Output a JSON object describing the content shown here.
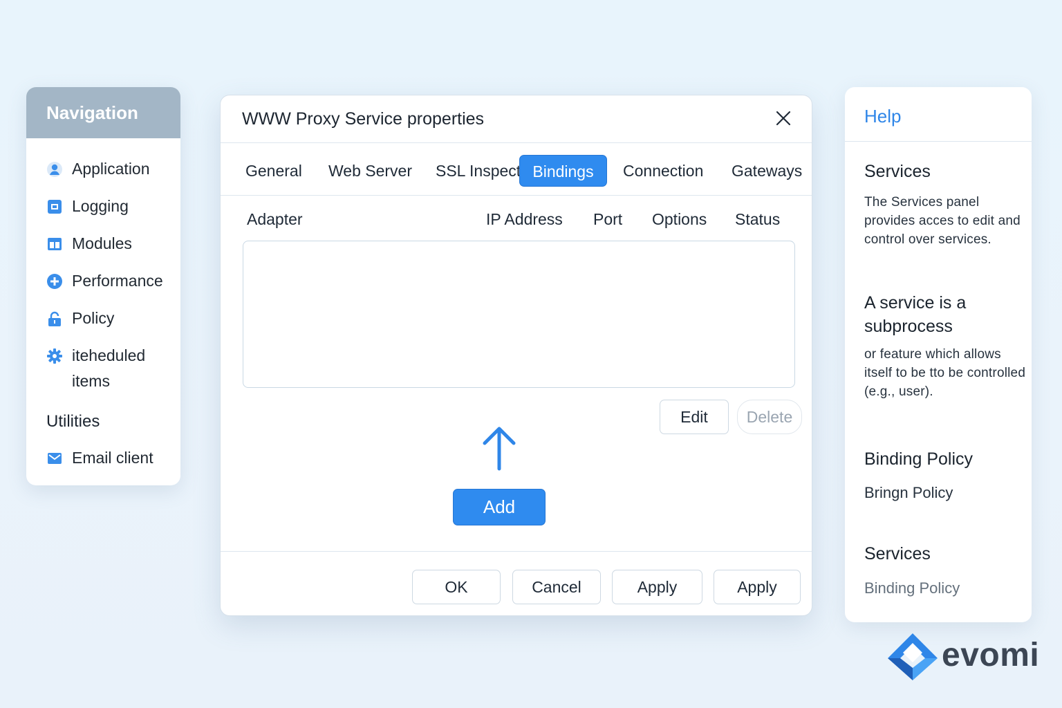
{
  "navigation": {
    "title": "Navigation",
    "items": [
      {
        "label": "Application",
        "icon": "user-icon"
      },
      {
        "label": "Logging",
        "icon": "log-icon"
      },
      {
        "label": "Modules",
        "icon": "modules-icon"
      },
      {
        "label": "Performance",
        "icon": "plus-circle-icon"
      },
      {
        "label": "Policy",
        "icon": "lock-icon"
      },
      {
        "label": "iteheduled items",
        "icon": "gear-icon"
      }
    ],
    "section_utilities": "Utilities",
    "utility_items": [
      {
        "label": "Email client",
        "icon": "mail-icon"
      }
    ]
  },
  "dialog": {
    "title": "WWW Proxy Service properties",
    "tabs": [
      "General",
      "Web Server",
      "SSL Inspect",
      "Bindings",
      "Connection",
      "Gateways"
    ],
    "active_tab": "Bindings",
    "columns": [
      "Adapter",
      "IP Address",
      "Port",
      "Options",
      "Status"
    ],
    "rows": [],
    "edit_label": "Edit",
    "delete_label": "Delete",
    "add_label": "Add",
    "footer": {
      "ok_label": "OK",
      "cancel_label": "Cancel",
      "apply_label": "Apply",
      "apply2_label": "Apply"
    }
  },
  "help": {
    "title": "Help",
    "services_heading": "Services",
    "services_text": "The Services panel provides acces to edit and control over services.",
    "subprocess_heading": "A service is a subprocess",
    "subprocess_text": "or feature which allows itself to be  tto be controlled (e.g., user).",
    "binding_heading": "Binding Policy",
    "binding_text": "Bringn  Policy",
    "services2_heading": "Services",
    "services2_text": "Binding Policy"
  },
  "brand": {
    "name": "evomi"
  },
  "colors": {
    "accent": "#2f8bef",
    "nav_header": "#a3b6c6",
    "help_link": "#2f86e8",
    "background": "#e8f4fc"
  }
}
